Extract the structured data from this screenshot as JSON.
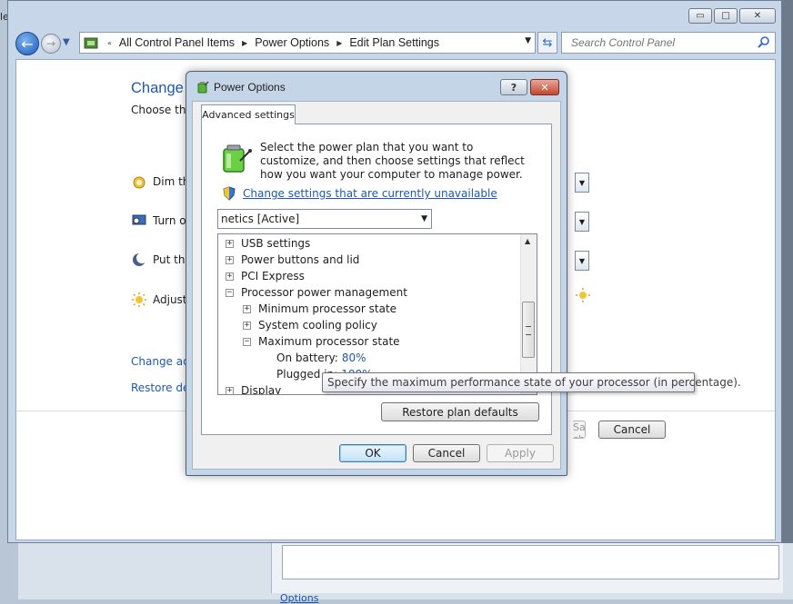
{
  "window": {
    "caption_minimize": "▭",
    "caption_maximize": "□",
    "caption_close": "✕"
  },
  "nav": {
    "breadcrumbs": [
      "All Control Panel Items",
      "Power Options",
      "Edit Plan Settings"
    ],
    "search_placeholder": "Search Control Panel"
  },
  "plan_page": {
    "title": "Change settings for the plan",
    "subtitle": "Choose the sleep and display settings",
    "rows": [
      {
        "label": "Dim the display:",
        "icon": "dim-display-icon"
      },
      {
        "label": "Turn off the display:",
        "icon": "display-off-icon"
      },
      {
        "label": "Put the computer to sleep:",
        "icon": "sleep-icon"
      },
      {
        "label": "Adjust plan brightness:",
        "icon": "brightness-icon"
      }
    ],
    "link_advanced": "Change advanced power settings",
    "link_restore": "Restore default settings for this plan",
    "save_button": "Save changes",
    "cancel_button": "Cancel"
  },
  "dialog": {
    "title": "Power Options",
    "help": "?",
    "close": "✕",
    "tab": "Advanced settings",
    "intro": "Select the power plan that you want to customize, and then choose settings that reflect how you want your computer to manage power.",
    "unavailable_link": "Change settings that are currently unavailable",
    "plan_selected": "netics [Active]",
    "tree": [
      {
        "label": "USB settings",
        "expander": "+",
        "level": 0
      },
      {
        "label": "Power buttons and lid",
        "expander": "+",
        "level": 0
      },
      {
        "label": "PCI Express",
        "expander": "+",
        "level": 0
      },
      {
        "label": "Processor power management",
        "expander": "−",
        "level": 0
      },
      {
        "label": "Minimum processor state",
        "expander": "+",
        "level": 1
      },
      {
        "label": "System cooling policy",
        "expander": "+",
        "level": 1
      },
      {
        "label": "Maximum processor state",
        "expander": "−",
        "level": 1
      },
      {
        "label": "On battery:",
        "value": "80%",
        "level": 2
      },
      {
        "label": "Plugged in:",
        "value": "100%",
        "level": 2
      },
      {
        "label": "Display",
        "expander": "+",
        "level": 0
      }
    ],
    "restore_button": "Restore plan defaults",
    "ok_button": "OK",
    "cancel_button": "Cancel",
    "apply_button": "Apply"
  },
  "tooltip": "Specify the maximum performance state of your processor (in percentage).",
  "background": {
    "left_edge_text": "le",
    "bottom_link": "Options"
  }
}
